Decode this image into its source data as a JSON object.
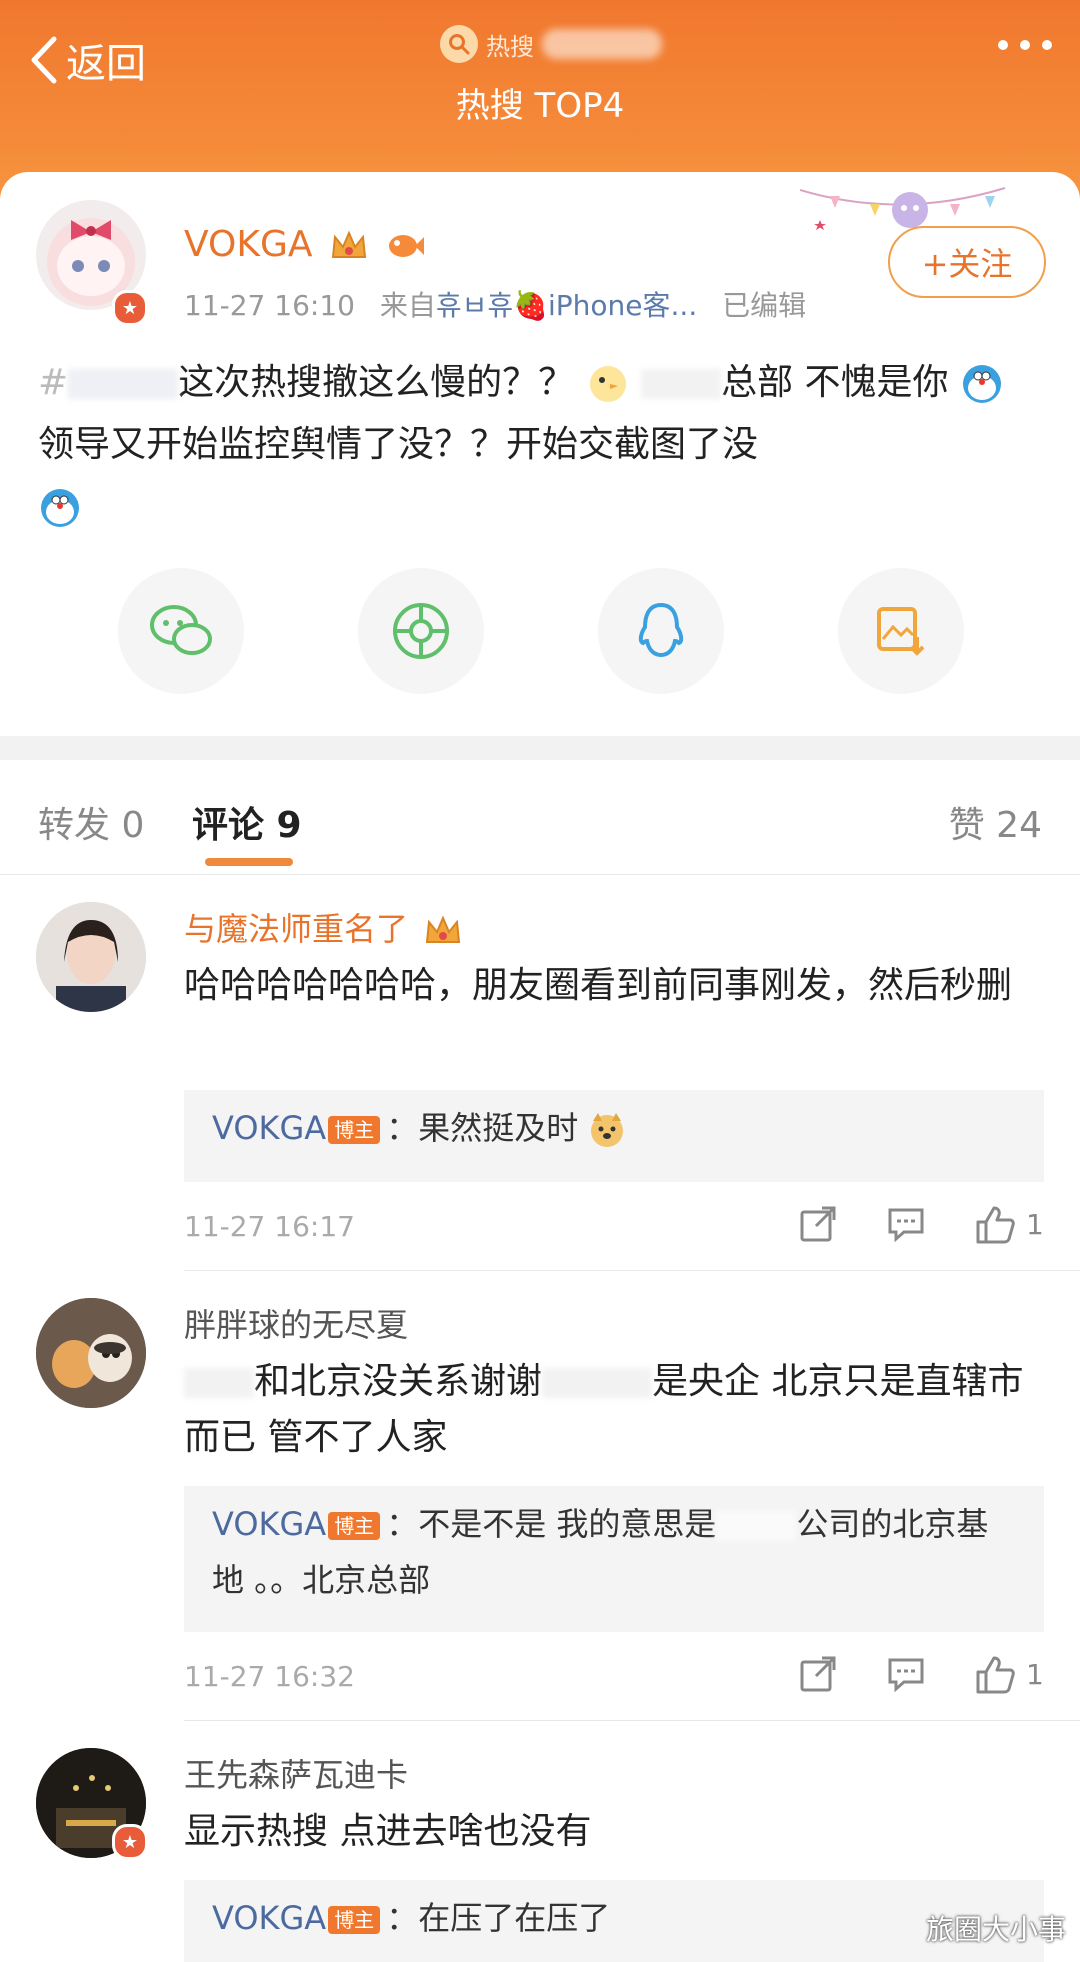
{
  "header": {
    "back_label": "返回",
    "hot_label": "热搜",
    "title": "热搜 TOP4"
  },
  "post": {
    "username": "VOKGA",
    "time": "11-27 16:10",
    "source_prefix": "来自",
    "source": "휴ㅂ휴🍓iPhone客...",
    "edited": "已编辑",
    "follow_label": "+关注",
    "text_part1": "#",
    "text_part2": "这次热搜撤这么慢的？？",
    "text_part3": "总部 不愧是你",
    "text_part4": "领导又开始监控舆情了没？？开始交截图了没"
  },
  "share": [
    "wechat-icon",
    "moments-icon",
    "qq-icon",
    "save-image-icon"
  ],
  "tabs": {
    "repost": "转发 0",
    "comments": "评论 9",
    "likes": "赞 24"
  },
  "comments": [
    {
      "name": "与魔法师重名了",
      "text": "哈哈哈哈哈哈哈，朋友圈看到前同事刚发，然后秒删",
      "reply_user": "VOKGA",
      "reply_badge": "博主",
      "reply_text": "：果然挺及时",
      "time": "11-27 16:17",
      "likes": "1"
    },
    {
      "name": "胖胖球的无尽夏",
      "text_a": "和北京没关系谢谢",
      "text_b": "是央企 北京只是直辖市而已 管不了人家",
      "reply_user": "VOKGA",
      "reply_badge": "博主",
      "reply_text_a": "：不是不是 我的意思是",
      "reply_text_b": "公司的北京基地 。。北京总部",
      "time": "11-27 16:32",
      "likes": "1"
    },
    {
      "name": "王先森萨瓦迪卡",
      "text": "显示热搜 点进去啥也没有",
      "reply_user": "VOKGA",
      "reply_badge": "博主",
      "reply_text": "：在压了在压了"
    }
  ],
  "watermark": "旅圈大小事",
  "colors": {
    "header": "#f0782e",
    "accent": "#e8742c",
    "reply_user": "#4d6aa0"
  }
}
